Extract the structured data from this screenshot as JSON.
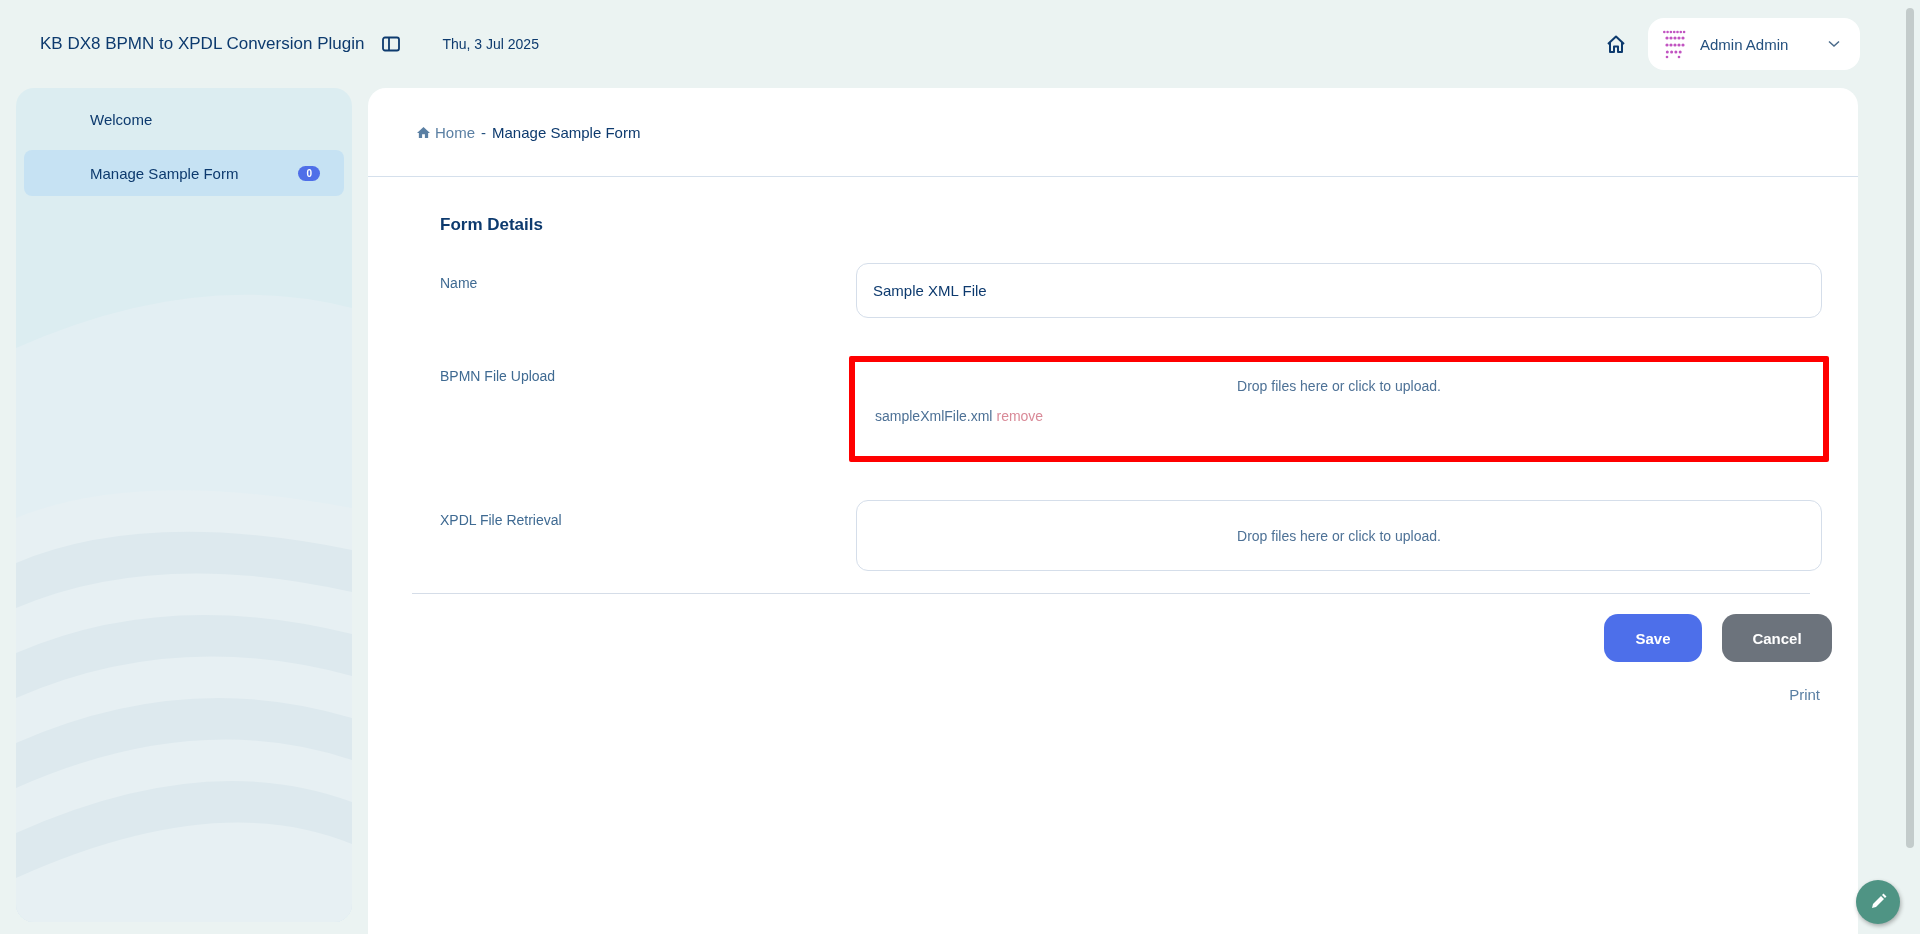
{
  "header": {
    "title": "KB DX8 BPMN to XPDL Conversion Plugin",
    "date": "Thu, 3 Jul 2025",
    "user": "Admin Admin"
  },
  "sidebar": {
    "items": [
      {
        "label": "Welcome",
        "selected": false
      },
      {
        "label": "Manage Sample Form",
        "selected": true,
        "badge": "0"
      }
    ]
  },
  "breadcrumb": {
    "home": "Home",
    "separator": "-",
    "current": "Manage Sample Form"
  },
  "form": {
    "title": "Form Details",
    "fields": [
      {
        "kind": "text",
        "label": "Name",
        "value": "Sample XML File"
      },
      {
        "kind": "upload",
        "label": "BPMN File Upload",
        "prompt": "Drop files here or click to upload.",
        "highlighted": true,
        "files": [
          {
            "name": "sampleXmlFile.xml",
            "action": "remove"
          }
        ]
      },
      {
        "kind": "upload",
        "label": "XPDL File Retrieval",
        "prompt": "Drop files here or click to upload.",
        "highlighted": false
      }
    ]
  },
  "buttons": [
    {
      "label": "Save",
      "kind": "primary"
    },
    {
      "label": "Cancel",
      "kind": "secondary"
    }
  ],
  "print_link": "Print"
}
